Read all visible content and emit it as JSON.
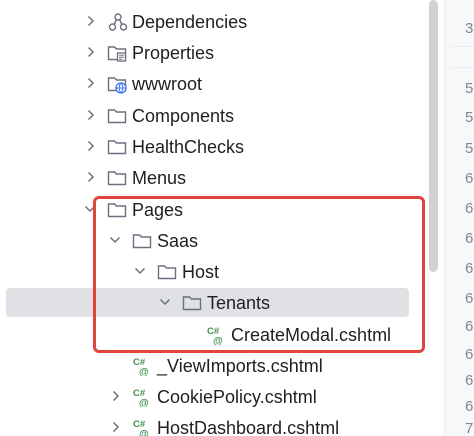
{
  "tree": {
    "items": [
      {
        "label": "Dependencies",
        "icon": "dependencies-icon",
        "expandable": true,
        "expanded": false
      },
      {
        "label": "Properties",
        "icon": "properties-folder-icon",
        "expandable": true,
        "expanded": false
      },
      {
        "label": "wwwroot",
        "icon": "web-folder-icon",
        "expandable": true,
        "expanded": false
      },
      {
        "label": "Components",
        "icon": "folder-icon",
        "expandable": true,
        "expanded": false
      },
      {
        "label": "HealthChecks",
        "icon": "folder-icon",
        "expandable": true,
        "expanded": false
      },
      {
        "label": "Menus",
        "icon": "folder-icon",
        "expandable": true,
        "expanded": false
      },
      {
        "label": "Pages",
        "icon": "folder-icon",
        "expandable": true,
        "expanded": true
      },
      {
        "label": "Saas",
        "icon": "folder-icon",
        "expandable": true,
        "expanded": true
      },
      {
        "label": "Host",
        "icon": "folder-icon",
        "expandable": true,
        "expanded": true
      },
      {
        "label": "Tenants",
        "icon": "folder-icon",
        "expandable": true,
        "expanded": true,
        "selected": true
      },
      {
        "label": "CreateModal.cshtml",
        "icon": "csharp-razor-file-icon",
        "expandable": false
      },
      {
        "label": "_ViewImports.cshtml",
        "icon": "csharp-razor-file-icon",
        "expandable": false
      },
      {
        "label": "CookiePolicy.cshtml",
        "icon": "csharp-razor-file-icon",
        "expandable": true,
        "expanded": false
      },
      {
        "label": "HostDashboard.cshtml",
        "icon": "csharp-razor-file-icon",
        "expandable": true,
        "expanded": false
      }
    ]
  },
  "gutter": {
    "numbers": [
      "3",
      "5",
      "5",
      "5",
      "6",
      "6",
      "6",
      "6",
      "6",
      "6",
      "6",
      "6",
      "6",
      "7"
    ]
  },
  "colors": {
    "highlight": "#e0443a",
    "selection": "#dfe1e5",
    "icon_stroke": "#6c707e",
    "csharp_green": "#3e8f4f",
    "web_blue": "#3574f0"
  },
  "icons": {
    "csharp_glyph": "C#",
    "at_glyph": "@"
  }
}
